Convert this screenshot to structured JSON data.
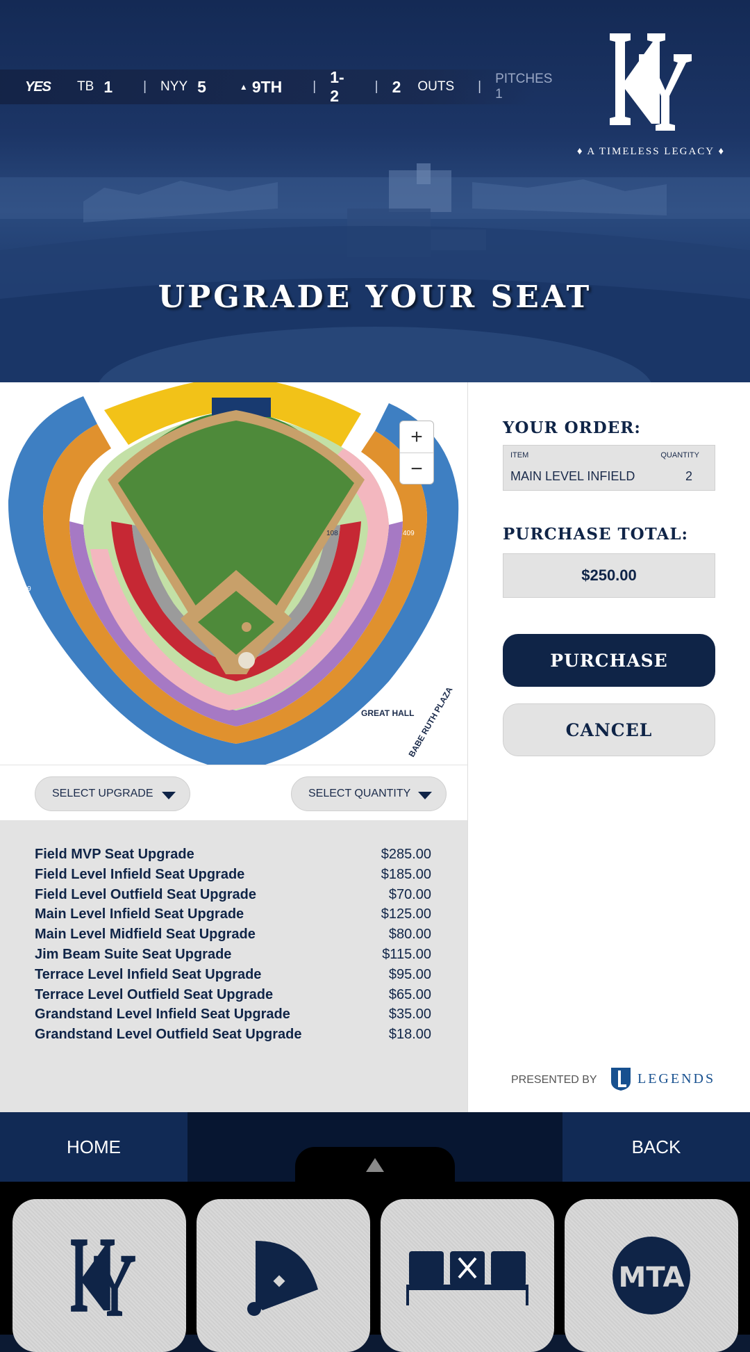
{
  "scorebar": {
    "network": "YES",
    "away_team": "TB",
    "away_score": "1",
    "home_team": "NYY",
    "home_score": "5",
    "inning": "9TH",
    "count": "1-2",
    "outs_num": "2",
    "outs_label": "OUTS",
    "pitches_label": "PITCHES 1"
  },
  "hero": {
    "tagline": "A TIMELESS LEGACY",
    "title": "UPGRADE YOUR SEAT"
  },
  "map": {
    "zoom_in": "+",
    "zoom_out": "−"
  },
  "selects": {
    "upgrade": "SELECT UPGRADE",
    "quantity": "SELECT QUANTITY"
  },
  "upgrades": [
    {
      "name": "Field MVP Seat Upgrade",
      "price": "$285.00"
    },
    {
      "name": "Field Level Infield Seat Upgrade",
      "price": "$185.00"
    },
    {
      "name": "Field Level Outfield Seat Upgrade",
      "price": "$70.00"
    },
    {
      "name": "Main Level Infield Seat Upgrade",
      "price": "$125.00"
    },
    {
      "name": "Main Level Midfield Seat Upgrade",
      "price": "$80.00"
    },
    {
      "name": "Jim Beam Suite Seat Upgrade",
      "price": "$115.00"
    },
    {
      "name": "Terrace Level Infield Seat Upgrade",
      "price": "$95.00"
    },
    {
      "name": "Terrace Level Outfield Seat Upgrade",
      "price": "$65.00"
    },
    {
      "name": "Grandstand Level Infield Seat Upgrade",
      "price": "$35.00"
    },
    {
      "name": "Grandstand Level Outfield Seat Upgrade",
      "price": "$18.00"
    }
  ],
  "order": {
    "heading": "YOUR ORDER:",
    "item_header": "ITEM",
    "quantity_header": "QUANTITY",
    "item": "MAIN LEVEL INFIELD",
    "quantity": "2",
    "total_heading": "PURCHASE TOTAL:",
    "total": "$250.00",
    "purchase": "PURCHASE",
    "cancel": "CANCEL",
    "presented_by": "PRESENTED BY",
    "sponsor": "LEGENDS"
  },
  "nav": {
    "home": "HOME",
    "back": "BACK"
  },
  "dock": [
    {
      "icon": "yankees-logo-icon"
    },
    {
      "icon": "ballfield-icon"
    },
    {
      "icon": "seats-dining-icon"
    },
    {
      "icon": "mta-icon"
    }
  ],
  "colors": {
    "navy": "#0f2447",
    "panel_gray": "#e3e3e3",
    "field_green": "#4e8a3a"
  }
}
